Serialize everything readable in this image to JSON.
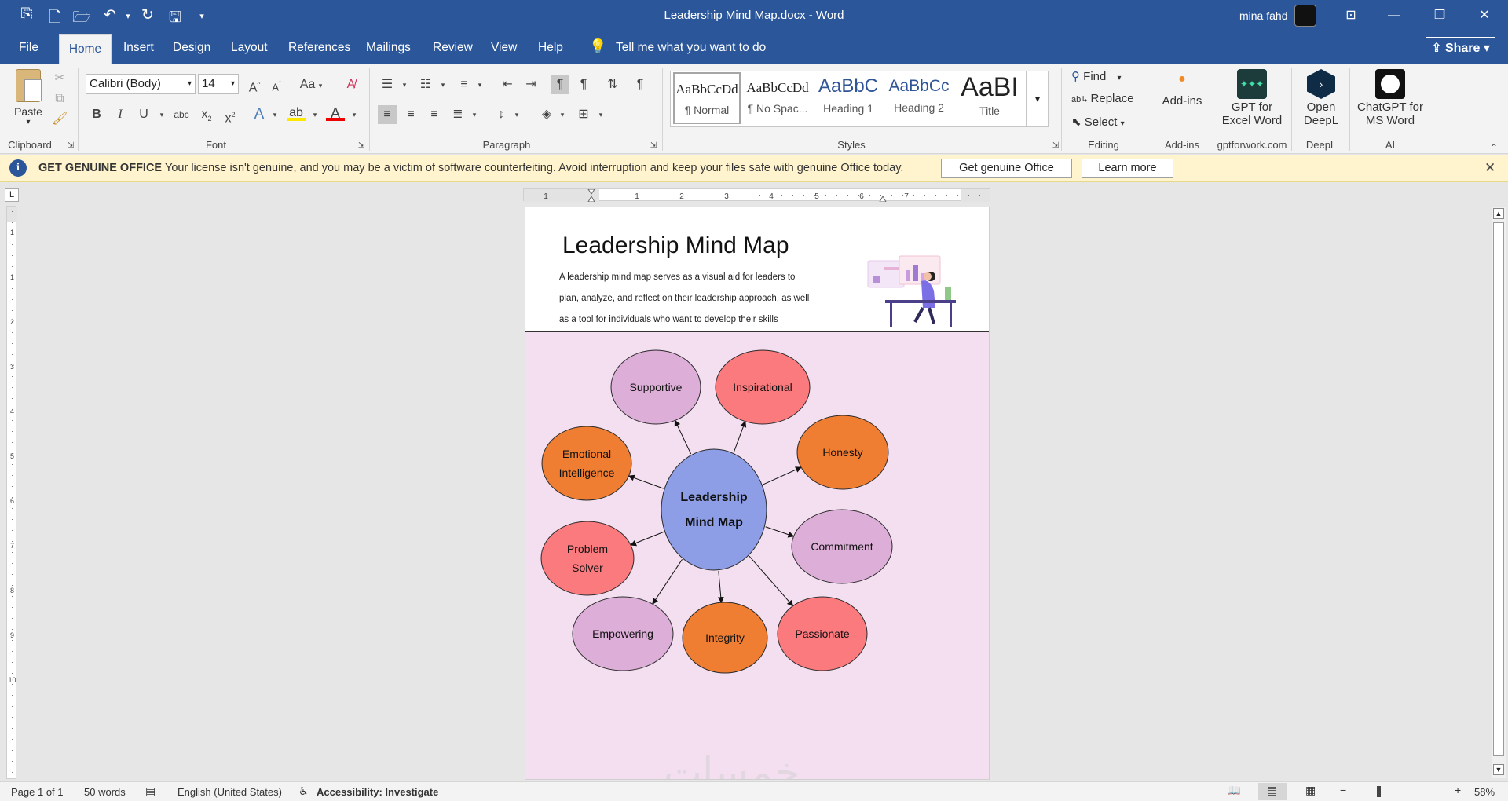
{
  "window": {
    "title": "Leadership Mind Map.docx  -  Word",
    "user": "mina fahd",
    "share_label": "Share"
  },
  "tabs": [
    "File",
    "Home",
    "Insert",
    "Design",
    "Layout",
    "References",
    "Mailings",
    "Review",
    "View",
    "Help"
  ],
  "tell_me": "Tell me what you want to do",
  "ribbon": {
    "clipboard": {
      "paste_label": "Paste",
      "group_label": "Clipboard"
    },
    "font": {
      "font_name": "Calibri (Body)",
      "font_size": "14",
      "case_label": "Aa",
      "group_label": "Font"
    },
    "paragraph": {
      "group_label": "Paragraph"
    },
    "styles": {
      "group_label": "Styles",
      "items": [
        {
          "preview": "AaBbCcDd",
          "name": "¶ Normal"
        },
        {
          "preview": "AaBbCcDd",
          "name": "¶ No Spac..."
        },
        {
          "preview": "AaBbC",
          "name": "Heading 1"
        },
        {
          "preview": "AaBbCc",
          "name": "Heading 2"
        },
        {
          "preview": "AaBI",
          "name": "Title"
        }
      ]
    },
    "editing": {
      "find": "Find",
      "replace": "Replace",
      "select": "Select",
      "group_label": "Editing"
    },
    "addins": {
      "label": "Add-ins",
      "group_label": "Add-ins"
    },
    "gpt_excel": {
      "line1": "GPT for",
      "line2": "Excel Word",
      "group_label": "gptforwork.com"
    },
    "deepl": {
      "line1": "Open",
      "line2": "DeepL",
      "group_label": "DeepL"
    },
    "chatgpt": {
      "line1": "ChatGPT for",
      "line2": "MS Word",
      "group_label": "AI"
    }
  },
  "banner": {
    "title": "GET GENUINE OFFICE",
    "message": "Your license isn't genuine, and you may be a victim of software counterfeiting. Avoid interruption and keep your files safe with genuine Office today.",
    "btn_primary": "Get genuine Office",
    "btn_secondary": "Learn more"
  },
  "document": {
    "heading": "Leadership Mind Map",
    "intro_lines": [
      "A leadership mind map serves as a visual aid for leaders to",
      "plan, analyze, and reflect on their leadership approach, as well",
      "as a tool for individuals who want to develop their skills"
    ],
    "center": [
      "Leadership",
      "Mind Map"
    ],
    "nodes": [
      {
        "lines": [
          "Supportive"
        ],
        "color": "#ddaed8"
      },
      {
        "lines": [
          "Inspirational"
        ],
        "color": "#fb7a7e"
      },
      {
        "lines": [
          "Honesty"
        ],
        "color": "#ef7e33"
      },
      {
        "lines": [
          "Commitment"
        ],
        "color": "#ddaed8"
      },
      {
        "lines": [
          "Passionate"
        ],
        "color": "#fb7a7e"
      },
      {
        "lines": [
          "Integrity"
        ],
        "color": "#ef7e33"
      },
      {
        "lines": [
          "Empowering"
        ],
        "color": "#ddaed8"
      },
      {
        "lines": [
          "Problem",
          "Solver"
        ],
        "color": "#fb7a7e"
      },
      {
        "lines": [
          "Emotional",
          "Intelligence"
        ],
        "color": "#ef7e33"
      }
    ],
    "center_color": "#8d9ee6"
  },
  "ruler_numbers": [
    "1",
    "1",
    "2",
    "3",
    "4",
    "5",
    "6",
    "7"
  ],
  "status": {
    "page": "Page 1 of 1",
    "words": "50 words",
    "language": "English (United States)",
    "accessibility": "Accessibility: Investigate",
    "zoom": "58%"
  }
}
